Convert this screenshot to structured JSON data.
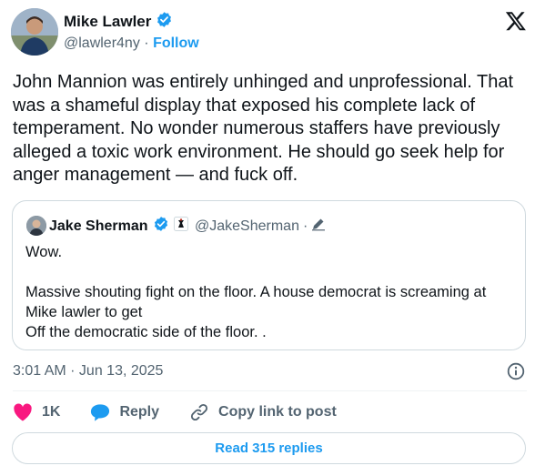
{
  "author": {
    "name": "Mike Lawler",
    "handle": "@lawler4ny",
    "separator": "·",
    "follow_label": "Follow",
    "verified_icon": "verified-badge-icon"
  },
  "tweet": {
    "text": "John Mannion was entirely unhinged and unprofessional. That was a shameful display that exposed his complete lack of temperament. No wonder numerous staffers have previously alleged a toxic work environment. He should go seek help for anger management — and fuck off."
  },
  "quote": {
    "name": "Jake Sherman",
    "handle": "@JakeSherman",
    "separator": "·",
    "text": "Wow.\n\nMassive shouting fight on the floor. A house democrat is screaming at Mike lawler to get\nOff the democratic side of the floor. ."
  },
  "timestamp": "3:01 AM · Jun 13, 2025",
  "actions": {
    "like_count": "1K",
    "reply_label": "Reply",
    "copy_label": "Copy link to post"
  },
  "read_replies_label": "Read 315 replies",
  "colors": {
    "accent": "#1d9bf0",
    "like": "#f91880",
    "text": "#0f1419",
    "muted": "#536471",
    "border": "#cfd9de"
  }
}
